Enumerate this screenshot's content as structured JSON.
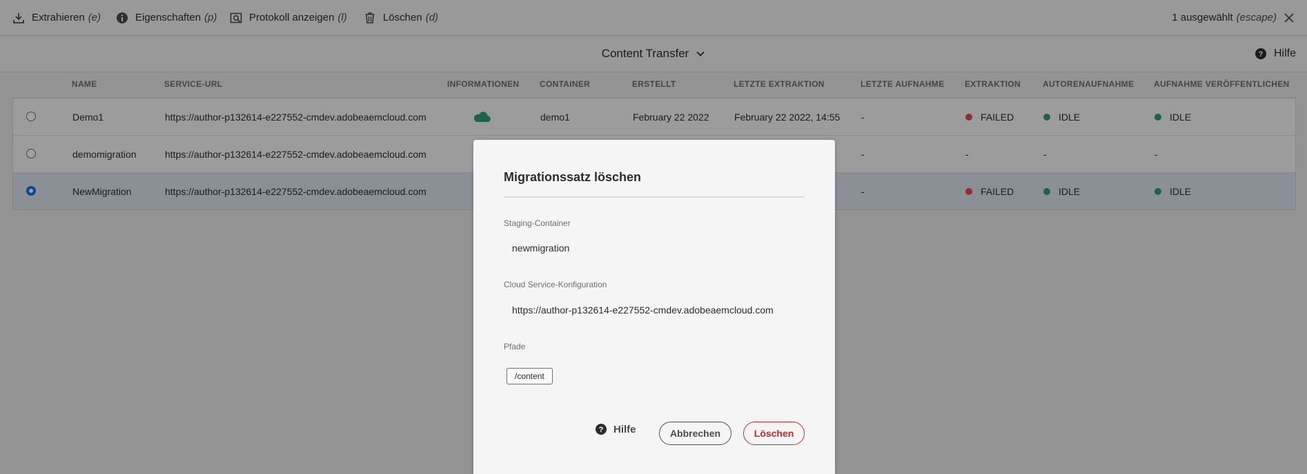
{
  "actionbar": {
    "extract": {
      "label": "Extrahieren",
      "key": "(e)"
    },
    "properties": {
      "label": "Eigenschaften",
      "key": "(p)"
    },
    "log": {
      "label": "Protokoll anzeigen",
      "key": "(l)"
    },
    "delete": {
      "label": "Löschen",
      "key": "(d)"
    },
    "selection": {
      "label": "1 ausgewählt",
      "key": "(escape)"
    }
  },
  "titlebar": {
    "title": "Content Transfer",
    "help": "Hilfe"
  },
  "table": {
    "headers": [
      "NAME",
      "SERVICE-URL",
      "INFORMATIONEN",
      "CONTAINER",
      "ERSTELLT",
      "LETZTE EXTRAKTION",
      "LETZTE AUFNAHME",
      "EXTRAKTION",
      "AUTORENAUFNAHME",
      "AUFNAHME VERÖFFENTLICHEN"
    ],
    "rows": [
      {
        "name": "Demo1",
        "url": "https://author-p132614-e227552-cmdev.adobeaemcloud.com",
        "info": "cloud-icon",
        "container": "demo1",
        "created": "February 22 2022",
        "last_extraction": "February 22 2022, 14:55",
        "last_ingestion": "-",
        "extraction": "FAILED",
        "author_ingestion": "IDLE",
        "publish_ingestion": "IDLE",
        "selected": false
      },
      {
        "name": "demomigration",
        "url": "https://author-p132614-e227552-cmdev.adobeaemcloud.com",
        "info": "",
        "container": "",
        "created": "",
        "last_extraction": "",
        "last_ingestion": "-",
        "extraction": "-",
        "author_ingestion": "-",
        "publish_ingestion": "-",
        "selected": false
      },
      {
        "name": "NewMigration",
        "url": "https://author-p132614-e227552-cmdev.adobeaemcloud.com",
        "info": "",
        "container": "",
        "created": "",
        "last_extraction": "",
        "last_ingestion": "-",
        "extraction": "FAILED",
        "author_ingestion": "IDLE",
        "publish_ingestion": "IDLE",
        "selected": true
      }
    ]
  },
  "dialog": {
    "title": "Migrationssatz löschen",
    "staging_label": "Staging-Container",
    "staging_value": "newmigration",
    "cloud_label": "Cloud Service-Konfiguration",
    "cloud_value": "https://author-p132614-e227552-cmdev.adobeaemcloud.com",
    "paths_label": "Pfade",
    "paths": [
      "/content"
    ],
    "help": "Hilfe",
    "cancel": "Abbrechen",
    "delete": "Löschen"
  },
  "colors": {
    "failed": "#e34850",
    "idle": "#2d9d78",
    "accent": "#1473e6",
    "danger": "#c9252d",
    "cloud": "#2d9d78"
  }
}
